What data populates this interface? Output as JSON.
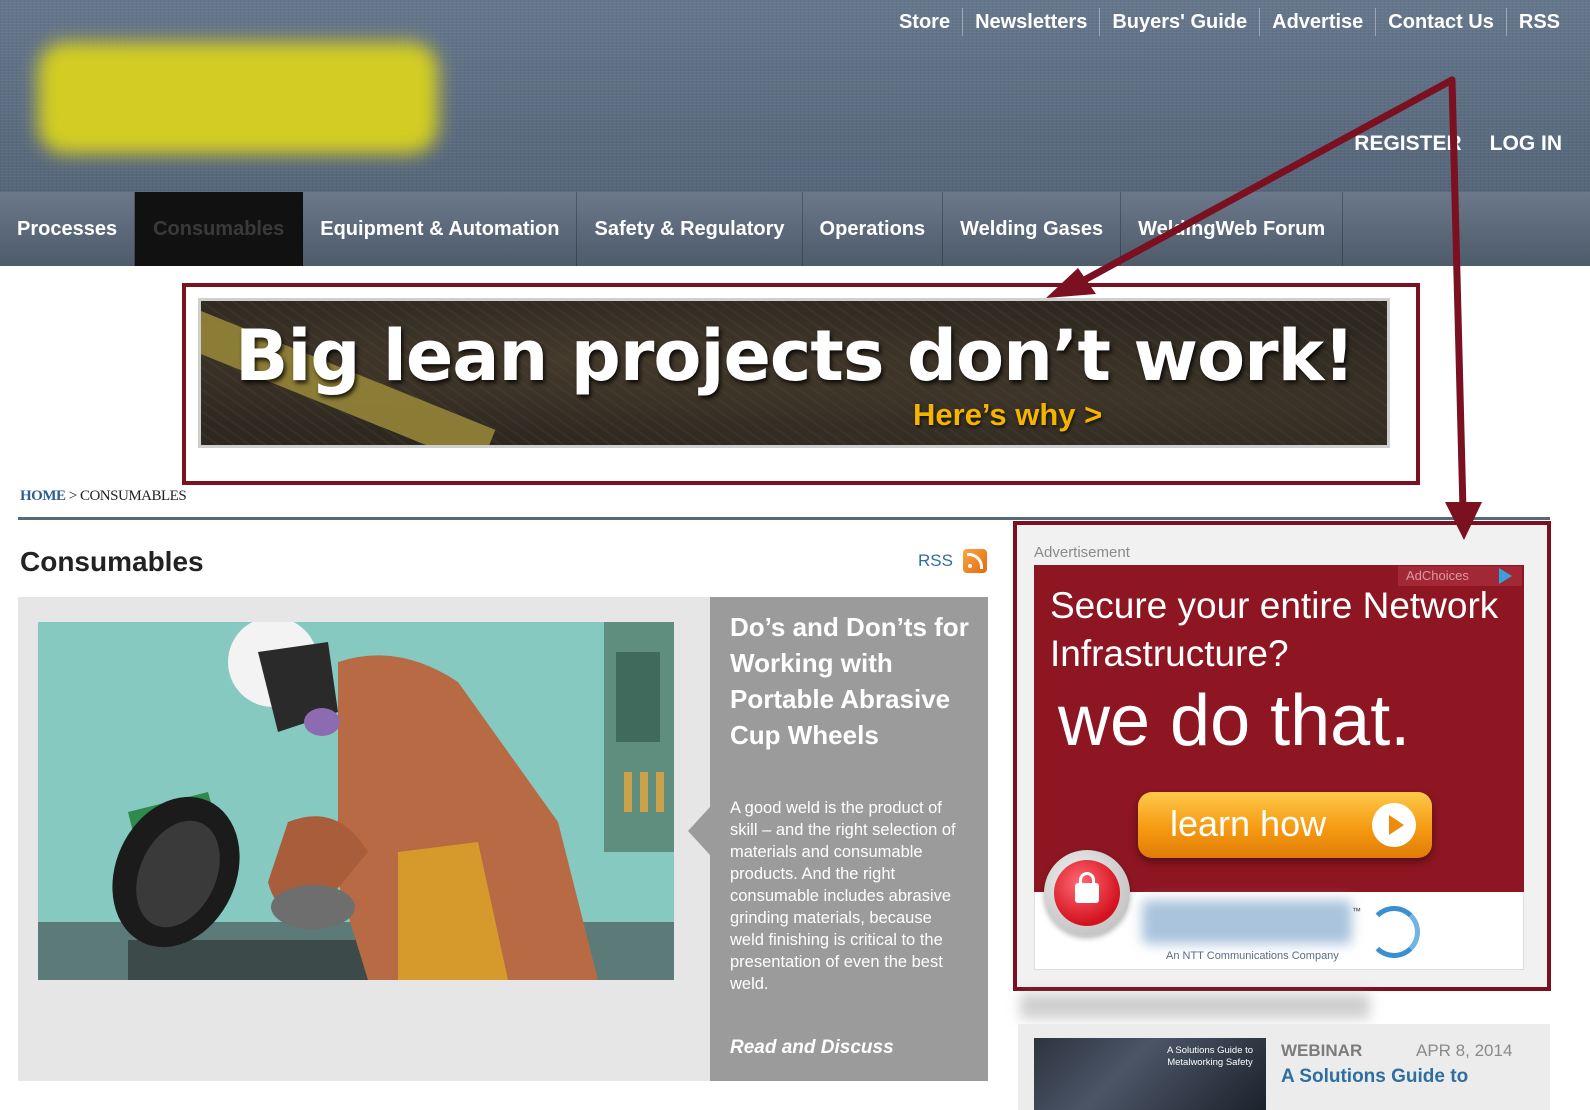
{
  "utility_nav": [
    "Store",
    "Newsletters",
    "Buyers' Guide",
    "Advertise",
    "Contact Us",
    "RSS"
  ],
  "auth": {
    "register": "REGISTER",
    "login": "LOG IN"
  },
  "main_nav": [
    "Processes",
    "Consumables",
    "Equipment & Automation",
    "Safety & Regulatory",
    "Operations",
    "Welding Gases",
    "WeldingWeb Forum"
  ],
  "active_nav": "Consumables",
  "banner_ad": {
    "headline": "Big lean projects don’t work!",
    "cta": "Here’s why >"
  },
  "breadcrumb": {
    "home": "HOME",
    "separator": ">",
    "current": "CONSUMABLES"
  },
  "section": {
    "title": "Consumables",
    "rss_label": "RSS"
  },
  "feature": {
    "title": "Do’s and Don’ts for Working with Portable Abrasive Cup Wheels",
    "excerpt": "A good weld is the product of skill – and the right selection of materials and consumable products. And the right consumable includes abrasive grinding materials, because weld finishing is critical to the presentation of even the best weld.",
    "read_more": "Read and Discuss"
  },
  "side_ad": {
    "label": "Advertisement",
    "adchoices": "AdChoices",
    "question": "Secure your entire Network Infrastructure?",
    "tagline": "we do that.",
    "cta": "learn how",
    "trademark": "™",
    "company_line": "An NTT Communications Company"
  },
  "webinar": {
    "type": "WEBINAR",
    "date": "APR 8, 2014",
    "title": "A Solutions Guide to",
    "thumb_text": "A Solutions Guide to Metalworking Safety"
  },
  "colors": {
    "header_bg": "#5b6b80",
    "annotation": "#7b1020",
    "ad_red": "#8e1622",
    "banner_cta": "#f5b400",
    "link_blue": "#2f6fa0"
  }
}
